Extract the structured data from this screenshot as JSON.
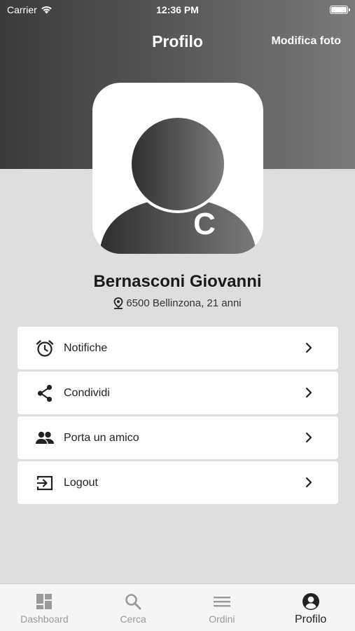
{
  "status_bar": {
    "carrier": "Carrier",
    "time": "12:36 PM"
  },
  "nav": {
    "title": "Profilo",
    "action_label": "Modifica foto"
  },
  "avatar": {
    "badge_letter": "C"
  },
  "user": {
    "name": "Bernasconi Giovanni",
    "location": "6500 Bellinzona, 21 anni"
  },
  "menu": {
    "items": [
      {
        "label": "Notifiche",
        "icon": "alarm-clock-icon"
      },
      {
        "label": "Condividi",
        "icon": "share-icon"
      },
      {
        "label": "Porta un amico",
        "icon": "people-icon"
      },
      {
        "label": "Logout",
        "icon": "logout-icon"
      }
    ]
  },
  "tab_bar": {
    "tabs": [
      {
        "label": "Dashboard",
        "icon": "dashboard-icon",
        "active": false
      },
      {
        "label": "Cerca",
        "icon": "search-icon",
        "active": false
      },
      {
        "label": "Ordini",
        "icon": "list-icon",
        "active": false
      },
      {
        "label": "Profilo",
        "icon": "profile-icon",
        "active": true
      }
    ]
  },
  "colors": {
    "header_dark": "#3b3b3b",
    "header_light": "#7a7a7a",
    "background": "#dedede",
    "card": "#ffffff"
  }
}
